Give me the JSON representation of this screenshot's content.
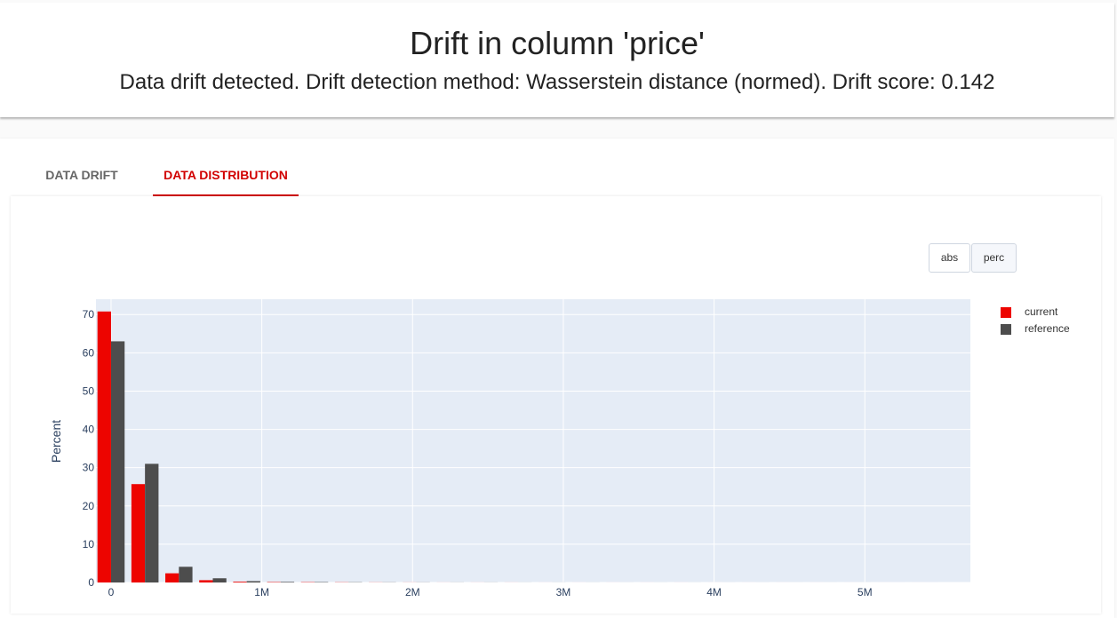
{
  "header": {
    "title": "Drift in column 'price'",
    "subtitle": "Data drift detected. Drift detection method: Wasserstein distance (normed). Drift score: 0.142"
  },
  "tabs": [
    {
      "label": "DATA DRIFT",
      "active": false
    },
    {
      "label": "DATA DISTRIBUTION",
      "active": true
    }
  ],
  "toggle": {
    "abs_label": "abs",
    "perc_label": "perc"
  },
  "chart_data": {
    "type": "bar",
    "ylabel": "Percent",
    "xlabel": "",
    "x_ticks": [
      {
        "value": 0,
        "label": "0"
      },
      {
        "value": 1000000,
        "label": "1M"
      },
      {
        "value": 2000000,
        "label": "2M"
      },
      {
        "value": 3000000,
        "label": "3M"
      },
      {
        "value": 4000000,
        "label": "4M"
      },
      {
        "value": 5000000,
        "label": "5M"
      }
    ],
    "y_ticks": [
      0,
      10,
      20,
      30,
      40,
      50,
      60,
      70
    ],
    "ylim": [
      0,
      74
    ],
    "xlim": [
      -100000,
      5700000
    ],
    "grid": true,
    "legend_position": "top-right",
    "bin_centers": [
      0,
      225000,
      450000,
      675000,
      900000,
      1125000,
      1350000,
      1575000,
      1800000,
      2025000,
      2250000,
      2475000,
      2700000,
      2925000,
      3150000,
      3375000,
      3600000,
      3825000,
      4050000,
      4275000,
      4500000,
      4725000,
      4950000,
      5175000,
      5400000
    ],
    "series": [
      {
        "name": "current",
        "color": "#ed0400",
        "values": [
          70.8,
          25.7,
          2.4,
          0.6,
          0.2,
          0.1,
          0.08,
          0.05,
          0.03,
          0.02,
          0.01,
          0.01,
          0.01,
          0.005,
          0.005,
          0.005,
          0.005,
          0.005,
          0.003,
          0.003,
          0.003,
          0.003,
          0.002,
          0.002,
          0.002
        ]
      },
      {
        "name": "reference",
        "color": "#4d4d4d",
        "values": [
          63.0,
          31.0,
          4.1,
          1.1,
          0.35,
          0.15,
          0.1,
          0.06,
          0.04,
          0.03,
          0.02,
          0.02,
          0.01,
          0.01,
          0.008,
          0.006,
          0.005,
          0.005,
          0.004,
          0.004,
          0.003,
          0.003,
          0.003,
          0.002,
          0.002
        ]
      }
    ]
  }
}
